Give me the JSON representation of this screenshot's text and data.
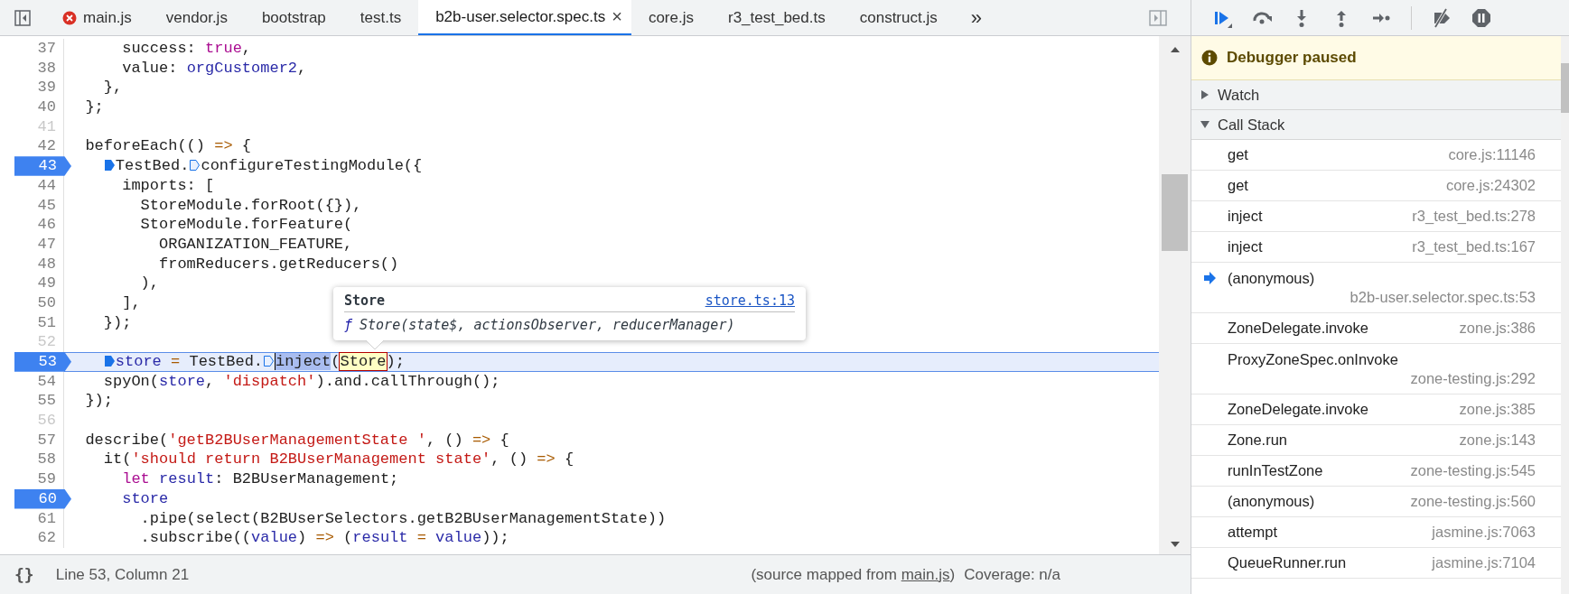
{
  "editor_tabs": {
    "overflow_glyph": "»",
    "items": [
      {
        "label": "main.js",
        "selected": false,
        "error": true
      },
      {
        "label": "vendor.js",
        "selected": false,
        "error": false
      },
      {
        "label": "bootstrap",
        "selected": false,
        "error": false
      },
      {
        "label": "test.ts",
        "selected": false,
        "error": false
      },
      {
        "label": "b2b-user.selector.spec.ts",
        "selected": true,
        "error": false,
        "close_glyph": "×"
      },
      {
        "label": "core.js",
        "selected": false,
        "error": false
      },
      {
        "label": "r3_test_bed.ts",
        "selected": false,
        "error": false
      },
      {
        "label": "construct.js",
        "selected": false,
        "error": false
      }
    ]
  },
  "code": {
    "lines": [
      {
        "number": "37",
        "breakpoint": false,
        "current": false,
        "dimmed": false,
        "tokens": [
          {
            "text": "      success: ",
            "kind": "plain"
          },
          {
            "text": "true",
            "kind": "keyword"
          },
          {
            "text": ",",
            "kind": "plain"
          }
        ]
      },
      {
        "number": "38",
        "breakpoint": false,
        "current": false,
        "dimmed": false,
        "tokens": [
          {
            "text": "      value: ",
            "kind": "plain"
          },
          {
            "text": "orgCustomer2",
            "kind": "variable"
          },
          {
            "text": ",",
            "kind": "plain"
          }
        ]
      },
      {
        "number": "39",
        "breakpoint": false,
        "current": false,
        "dimmed": false,
        "tokens": [
          {
            "text": "    },",
            "kind": "plain"
          }
        ]
      },
      {
        "number": "40",
        "breakpoint": false,
        "current": false,
        "dimmed": false,
        "tokens": [
          {
            "text": "  };",
            "kind": "plain"
          }
        ]
      },
      {
        "number": "41",
        "breakpoint": false,
        "current": false,
        "dimmed": true
      },
      {
        "number": "42",
        "breakpoint": false,
        "current": false,
        "dimmed": false,
        "tokens": [
          {
            "text": "  beforeEach(() ",
            "kind": "plain"
          },
          {
            "text": "=>",
            "kind": "operator"
          },
          {
            "text": " {",
            "kind": "plain"
          }
        ]
      },
      {
        "number": "43",
        "breakpoint": true,
        "current": false,
        "dimmed": false,
        "tokens": [
          {
            "text": "    TestBed.",
            "kind": "plain",
            "inline_breakpoint": true,
            "marker_filled": true
          },
          {
            "text": "configureTestingModule({",
            "kind": "plain",
            "inline_breakpoint": true,
            "marker_filled": false
          }
        ]
      },
      {
        "number": "44",
        "breakpoint": false,
        "current": false,
        "dimmed": false,
        "tokens": [
          {
            "text": "      imports: [",
            "kind": "plain"
          }
        ]
      },
      {
        "number": "45",
        "breakpoint": false,
        "current": false,
        "dimmed": false,
        "tokens": [
          {
            "text": "        StoreModule.forRoot({}),",
            "kind": "plain"
          }
        ]
      },
      {
        "number": "46",
        "breakpoint": false,
        "current": false,
        "dimmed": false,
        "tokens": [
          {
            "text": "        StoreModule.forFeature(",
            "kind": "plain"
          }
        ]
      },
      {
        "number": "47",
        "breakpoint": false,
        "current": false,
        "dimmed": false,
        "tokens": [
          {
            "text": "          ORGANIZATION_FEATURE,",
            "kind": "plain"
          }
        ]
      },
      {
        "number": "48",
        "breakpoint": false,
        "current": false,
        "dimmed": false,
        "tokens": [
          {
            "text": "          fromReducers.getReducers()",
            "kind": "plain"
          }
        ]
      },
      {
        "number": "49",
        "breakpoint": false,
        "current": false,
        "dimmed": false,
        "tokens": [
          {
            "text": "        ),",
            "kind": "plain"
          }
        ]
      },
      {
        "number": "50",
        "breakpoint": false,
        "current": false,
        "dimmed": false,
        "tokens": [
          {
            "text": "      ],",
            "kind": "plain"
          }
        ]
      },
      {
        "number": "51",
        "breakpoint": false,
        "current": false,
        "dimmed": false,
        "tokens": [
          {
            "text": "    });",
            "kind": "plain"
          }
        ]
      },
      {
        "number": "52",
        "breakpoint": false,
        "current": false,
        "dimmed": true
      },
      {
        "number": "53",
        "breakpoint": true,
        "current": true,
        "dimmed": false,
        "tokens": [
          {
            "text": "    store",
            "kind": "variable",
            "inline_breakpoint": true,
            "marker_filled": true
          },
          {
            "text": " =",
            "kind": "operator"
          },
          {
            "text": " TestBed.",
            "kind": "plain"
          },
          {
            "text": "inject",
            "kind": "selection",
            "inline_breakpoint": true,
            "marker_filled": false
          },
          {
            "text": "(",
            "kind": "plain"
          },
          {
            "text": "Store",
            "kind": "hover"
          },
          {
            "text": ");",
            "kind": "plain"
          }
        ]
      },
      {
        "number": "54",
        "breakpoint": false,
        "current": false,
        "dimmed": false,
        "tokens": [
          {
            "text": "    spyOn(",
            "kind": "plain"
          },
          {
            "text": "store",
            "kind": "variable"
          },
          {
            "text": ", ",
            "kind": "plain"
          },
          {
            "text": "'dispatch'",
            "kind": "string"
          },
          {
            "text": ").and.callThrough();",
            "kind": "plain"
          }
        ]
      },
      {
        "number": "55",
        "breakpoint": false,
        "current": false,
        "dimmed": false,
        "tokens": [
          {
            "text": "  });",
            "kind": "plain"
          }
        ]
      },
      {
        "number": "56",
        "breakpoint": false,
        "current": false,
        "dimmed": true
      },
      {
        "number": "57",
        "breakpoint": false,
        "current": false,
        "dimmed": false,
        "tokens": [
          {
            "text": "  describe(",
            "kind": "plain"
          },
          {
            "text": "'getB2BUserManagementState '",
            "kind": "string"
          },
          {
            "text": ", () ",
            "kind": "plain"
          },
          {
            "text": "=>",
            "kind": "operator"
          },
          {
            "text": " {",
            "kind": "plain"
          }
        ]
      },
      {
        "number": "58",
        "breakpoint": false,
        "current": false,
        "dimmed": false,
        "tokens": [
          {
            "text": "    it(",
            "kind": "plain"
          },
          {
            "text": "'should return B2BUserManagement state'",
            "kind": "string"
          },
          {
            "text": ", () ",
            "kind": "plain"
          },
          {
            "text": "=>",
            "kind": "operator"
          },
          {
            "text": " {",
            "kind": "plain"
          }
        ]
      },
      {
        "number": "59",
        "breakpoint": false,
        "current": false,
        "dimmed": false,
        "tokens": [
          {
            "text": "      let",
            "kind": "keyword"
          },
          {
            "text": " result",
            "kind": "variable"
          },
          {
            "text": ": B2BUserManagement;",
            "kind": "plain"
          }
        ]
      },
      {
        "number": "60",
        "breakpoint": true,
        "current": false,
        "dimmed": false,
        "tokens": [
          {
            "text": "      store",
            "kind": "variable"
          }
        ]
      },
      {
        "number": "61",
        "breakpoint": false,
        "current": false,
        "dimmed": false,
        "tokens": [
          {
            "text": "        .pipe(select(B2BUserSelectors.getB2BUserManagementState))",
            "kind": "plain"
          }
        ]
      },
      {
        "number": "62",
        "breakpoint": false,
        "current": false,
        "dimmed": false,
        "tokens": [
          {
            "text": "        .subscribe((",
            "kind": "plain"
          },
          {
            "text": "value",
            "kind": "variable"
          },
          {
            "text": ") ",
            "kind": "plain"
          },
          {
            "text": "=>",
            "kind": "operator"
          },
          {
            "text": " (",
            "kind": "plain"
          },
          {
            "text": "result",
            "kind": "variable"
          },
          {
            "text": " =",
            "kind": "operator"
          },
          {
            "text": " value",
            "kind": "variable"
          },
          {
            "text": "));",
            "kind": "plain"
          }
        ]
      }
    ]
  },
  "tooltip": {
    "title": "Store",
    "link": "store.ts:13",
    "fn_glyph": "ƒ",
    "signature": "Store(state$, actionsObserver, reducerManager)"
  },
  "status_bar": {
    "format_glyph": "{}",
    "position": "Line 53, Column 21",
    "source_prefix": "(source mapped from ",
    "source_link": "main.js",
    "source_suffix": ")",
    "coverage": "Coverage: n/a"
  },
  "debugger": {
    "toolbar": [
      {
        "kind": "resume"
      },
      {
        "kind": "step-over"
      },
      {
        "kind": "step-into"
      },
      {
        "kind": "step-out"
      },
      {
        "kind": "step"
      },
      {
        "kind": "separator"
      },
      {
        "kind": "deactivate"
      },
      {
        "kind": "pause-exceptions"
      }
    ],
    "banner": "Debugger paused",
    "sections": [
      {
        "title": "Watch",
        "expanded": false
      },
      {
        "title": "Call Stack",
        "expanded": true
      }
    ],
    "frames": [
      {
        "name": "get",
        "location": "core.js:11146",
        "current": false,
        "wrapped": false
      },
      {
        "name": "get",
        "location": "core.js:24302",
        "current": false,
        "wrapped": false
      },
      {
        "name": "inject",
        "location": "r3_test_bed.ts:278",
        "current": false,
        "wrapped": false
      },
      {
        "name": "inject",
        "location": "r3_test_bed.ts:167",
        "current": false,
        "wrapped": false
      },
      {
        "name": "(anonymous)",
        "location": "b2b-user.selector.spec.ts:53",
        "current": true,
        "wrapped": true
      },
      {
        "name": "ZoneDelegate.invoke",
        "location": "zone.js:386",
        "current": false,
        "wrapped": false
      },
      {
        "name": "ProxyZoneSpec.onInvoke",
        "location": "zone-testing.js:292",
        "current": false,
        "wrapped": true
      },
      {
        "name": "ZoneDelegate.invoke",
        "location": "zone.js:385",
        "current": false,
        "wrapped": false
      },
      {
        "name": "Zone.run",
        "location": "zone.js:143",
        "current": false,
        "wrapped": false
      },
      {
        "name": "runInTestZone",
        "location": "zone-testing.js:545",
        "current": false,
        "wrapped": false
      },
      {
        "name": "(anonymous)",
        "location": "zone-testing.js:560",
        "current": false,
        "wrapped": false
      },
      {
        "name": "attempt",
        "location": "jasmine.js:7063",
        "current": false,
        "wrapped": false
      },
      {
        "name": "QueueRunner.run",
        "location": "jasmine.js:7104",
        "current": false,
        "wrapped": false
      }
    ]
  }
}
